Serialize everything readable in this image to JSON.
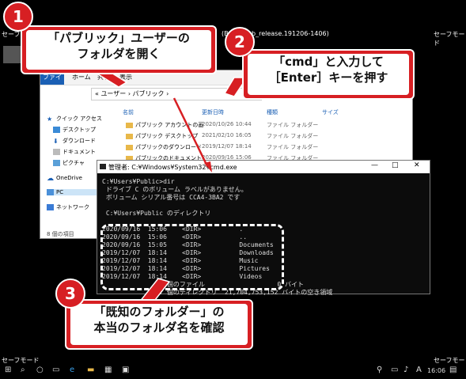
{
  "screen": {
    "safe_mode_label": "セーフモード",
    "build_fragment": "(Bu",
    "build_fragment2": "b_release.191206-1406)"
  },
  "explorer": {
    "ribbon_tabs": [
      "ファイル",
      "ホーム",
      "共有",
      "表示"
    ],
    "address": "« ユーザー › パブリック ›",
    "nav_items": [
      {
        "icon": "star-icon",
        "label": "クイック アクセス"
      },
      {
        "icon": "desktop-icon",
        "label": "デスクトップ"
      },
      {
        "icon": "download-icon",
        "label": "ダウンロード"
      },
      {
        "icon": "document-icon",
        "label": "ドキュメント"
      },
      {
        "icon": "picture-icon",
        "label": "ピクチャ"
      },
      {
        "icon": "onedrive-icon",
        "label": "OneDrive"
      },
      {
        "icon": "pc-icon",
        "label": "PC"
      },
      {
        "icon": "network-icon",
        "label": "ネットワーク"
      }
    ],
    "columns": [
      "名前",
      "更新日時",
      "種類",
      "サイズ"
    ],
    "files": [
      {
        "name": "パブリック アカウントの画",
        "date": "2020/10/26 10:44",
        "type": "ファイル フォルダー"
      },
      {
        "name": "パブリック デスクトップ",
        "date": "2021/02/10 16:05",
        "type": "ファイル フォルダー"
      },
      {
        "name": "パブリックのダウンロード",
        "date": "2019/12/07 18:14",
        "type": "ファイル フォルダー"
      },
      {
        "name": "パブリックのドキュメント",
        "date": "2020/09/16 15:06",
        "type": "ファイル フォルダー"
      }
    ],
    "status": "8 個の項目"
  },
  "console": {
    "title": "管理者: C:¥Windows¥System32¥cmd.exe",
    "min": "—",
    "max": "□",
    "close": "✕",
    "lines": [
      "C:¥Users¥Public>dir",
      " ドライブ C のボリューム ラベルがありません。",
      " ボリューム シリアル番号は CCA4-3BA2 です",
      "",
      " C:¥Users¥Public のディレクトリ",
      "",
      "2020/09/16  15:06    <DIR>          .",
      "2020/09/16  15:06    <DIR>          ..",
      "2020/09/16  15:05    <DIR>          Documents",
      "2019/12/07  18:14    <DIR>          Downloads",
      "2019/12/07  18:14    <DIR>          Music",
      "2019/12/07  18:14    <DIR>          Pictures",
      "2019/12/07  18:14    <DIR>          Videos",
      "               0 個のファイル                   0 バイト",
      "               7 個のディレクトリ  21,704,753,152 バイトの空き領域",
      "",
      "C:¥Users¥Public>"
    ]
  },
  "callouts": {
    "c1_num": "1",
    "c1_line1": "「パブリック」ユーザーの",
    "c1_line2": "フォルダを開く",
    "c2_num": "2",
    "c2_line1": "「cmd」と入力して",
    "c2_line2": "［Enter］キーを押す",
    "c3_num": "3",
    "c3_line1": "「既知のフォルダー」の",
    "c3_line2": "本当のフォルダ名を確認"
  },
  "taskbar": {
    "lang": "A",
    "time": "16:06"
  },
  "colors": {
    "callout_red": "#d71f23",
    "folder": "#e8b84a",
    "accent": "#1a5fb4"
  }
}
